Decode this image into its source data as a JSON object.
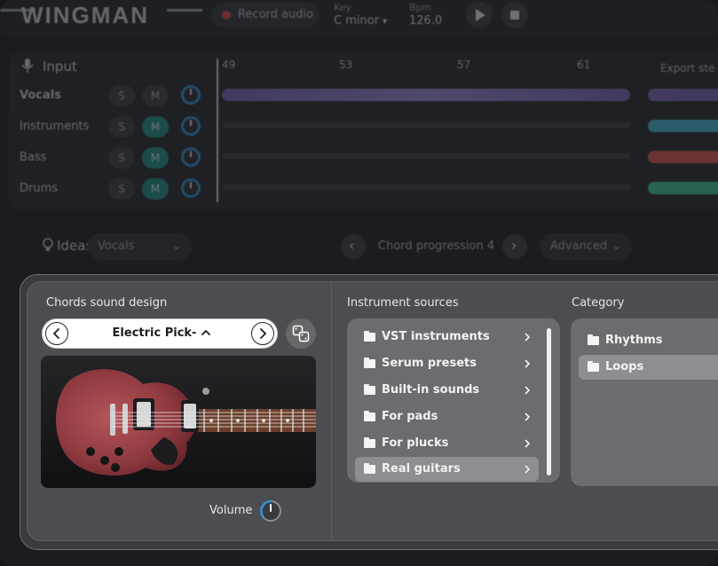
{
  "app": {
    "logo": "WINGMAN",
    "record_label": "Record audio",
    "key_label": "Key",
    "key_value": "C minor",
    "bpm_label": "Bpm",
    "bpm_value": "126.0"
  },
  "input_panel": {
    "title": "Input",
    "export_label": "Export ste",
    "ruler": [
      "49",
      "53",
      "57",
      "61"
    ],
    "tracks": [
      {
        "name": "Vocals",
        "solo": "S",
        "mute": "M",
        "mute_on": false
      },
      {
        "name": "Instruments",
        "solo": "S",
        "mute": "M",
        "mute_on": true
      },
      {
        "name": "Bass",
        "solo": "S",
        "mute": "M",
        "mute_on": true
      },
      {
        "name": "Drums",
        "solo": "S",
        "mute": "M",
        "mute_on": true
      }
    ]
  },
  "ideas": {
    "title": "Ideas",
    "source_value": "Vocals",
    "progression": "Chord progression 4",
    "advanced_label": "Advanced"
  },
  "dialog": {
    "sound_design": {
      "title": "Chords sound design",
      "preset_name": "Electric Pick-up",
      "volume_label": "Volume"
    },
    "instrument_sources": {
      "title": "Instrument sources",
      "items": [
        {
          "label": "VST instruments",
          "selected": false
        },
        {
          "label": "Serum presets",
          "selected": false
        },
        {
          "label": "Built-in sounds",
          "selected": false
        },
        {
          "label": "For pads",
          "selected": false
        },
        {
          "label": "For plucks",
          "selected": false
        },
        {
          "label": "Real guitars",
          "selected": true
        }
      ]
    },
    "category": {
      "title": "Category",
      "items": [
        {
          "label": "Rhythms",
          "selected": false
        },
        {
          "label": "Loops",
          "selected": true
        }
      ]
    }
  },
  "icons": {
    "mic": "mic-icon",
    "bulb": "lightbulb-icon",
    "folder": "folder-icon",
    "dice": "dice-icon",
    "chevron_right": "chevron-right-icon",
    "chevron_left": "chevron-left-icon",
    "chevron_up": "chevron-up-icon",
    "chevron_down": "chevron-down-icon",
    "play": "play-icon",
    "stop": "stop-icon"
  },
  "colors": {
    "accent_teal": "#1f8d8a",
    "knob_blue": "#2a8fd8",
    "record_red": "#e04848",
    "wave_purple": "#7a62b8",
    "wave_cyan": "#3fb7d0",
    "wave_red": "#d8574f",
    "wave_green": "#39c2a0"
  }
}
